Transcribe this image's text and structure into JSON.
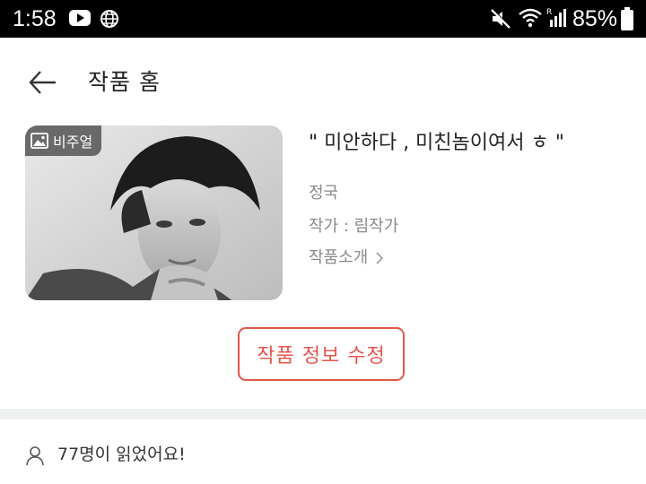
{
  "status_bar": {
    "time": "1:58",
    "battery": "85%",
    "icons": [
      "youtube-icon",
      "globe-icon",
      "mute-icon",
      "wifi-icon",
      "signal-icon",
      "battery-icon"
    ]
  },
  "header": {
    "title": "작품 홈",
    "back_icon": "back-arrow-icon"
  },
  "work": {
    "cover_badge": "비주얼",
    "title": "\" 미안하다 , 미친놈이여서 ㅎ \"",
    "subtitle": "정국",
    "author": "작가 : 림작가",
    "intro_label": "작품소개",
    "edit_button": "작품 정보 수정"
  },
  "readers": {
    "text": "77명이 읽었어요!"
  },
  "colors": {
    "accent": "#e2574c",
    "muted_text": "#8a8a8a",
    "divider": "#eef0f1",
    "status_bar": "#000000"
  }
}
